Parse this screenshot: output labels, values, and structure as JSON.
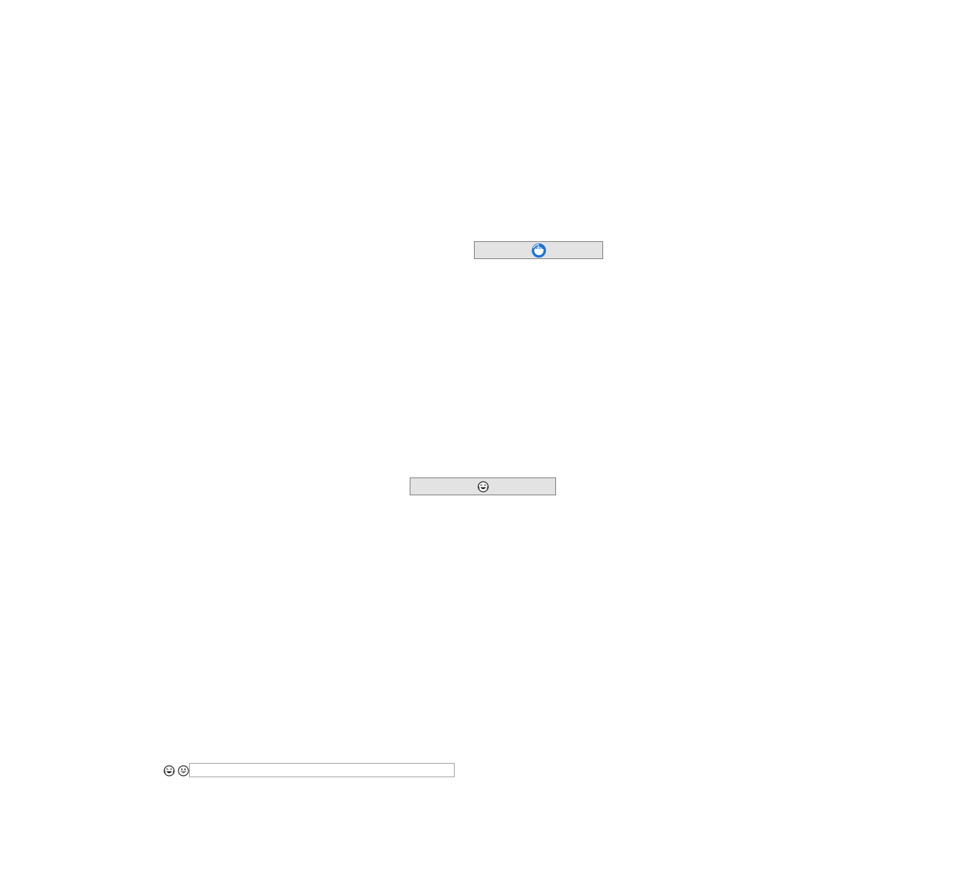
{
  "icons": {
    "top_button_icon": "blue-cityscape-circle-icon",
    "middle_button_icon": "face-with-tears-of-joy-icon",
    "left_emoji_1": "face-with-tears-of-joy-icon",
    "left_emoji_2": "grinning-face-with-big-eyes-icon"
  },
  "colors": {
    "accent_blue": "#1e73d2",
    "button_bg": "#e3e3e3",
    "button_border": "#7a7a7a",
    "input_border": "#a0a0a0",
    "emoji_stroke": "#222222"
  },
  "input": {
    "value": "",
    "placeholder": ""
  }
}
